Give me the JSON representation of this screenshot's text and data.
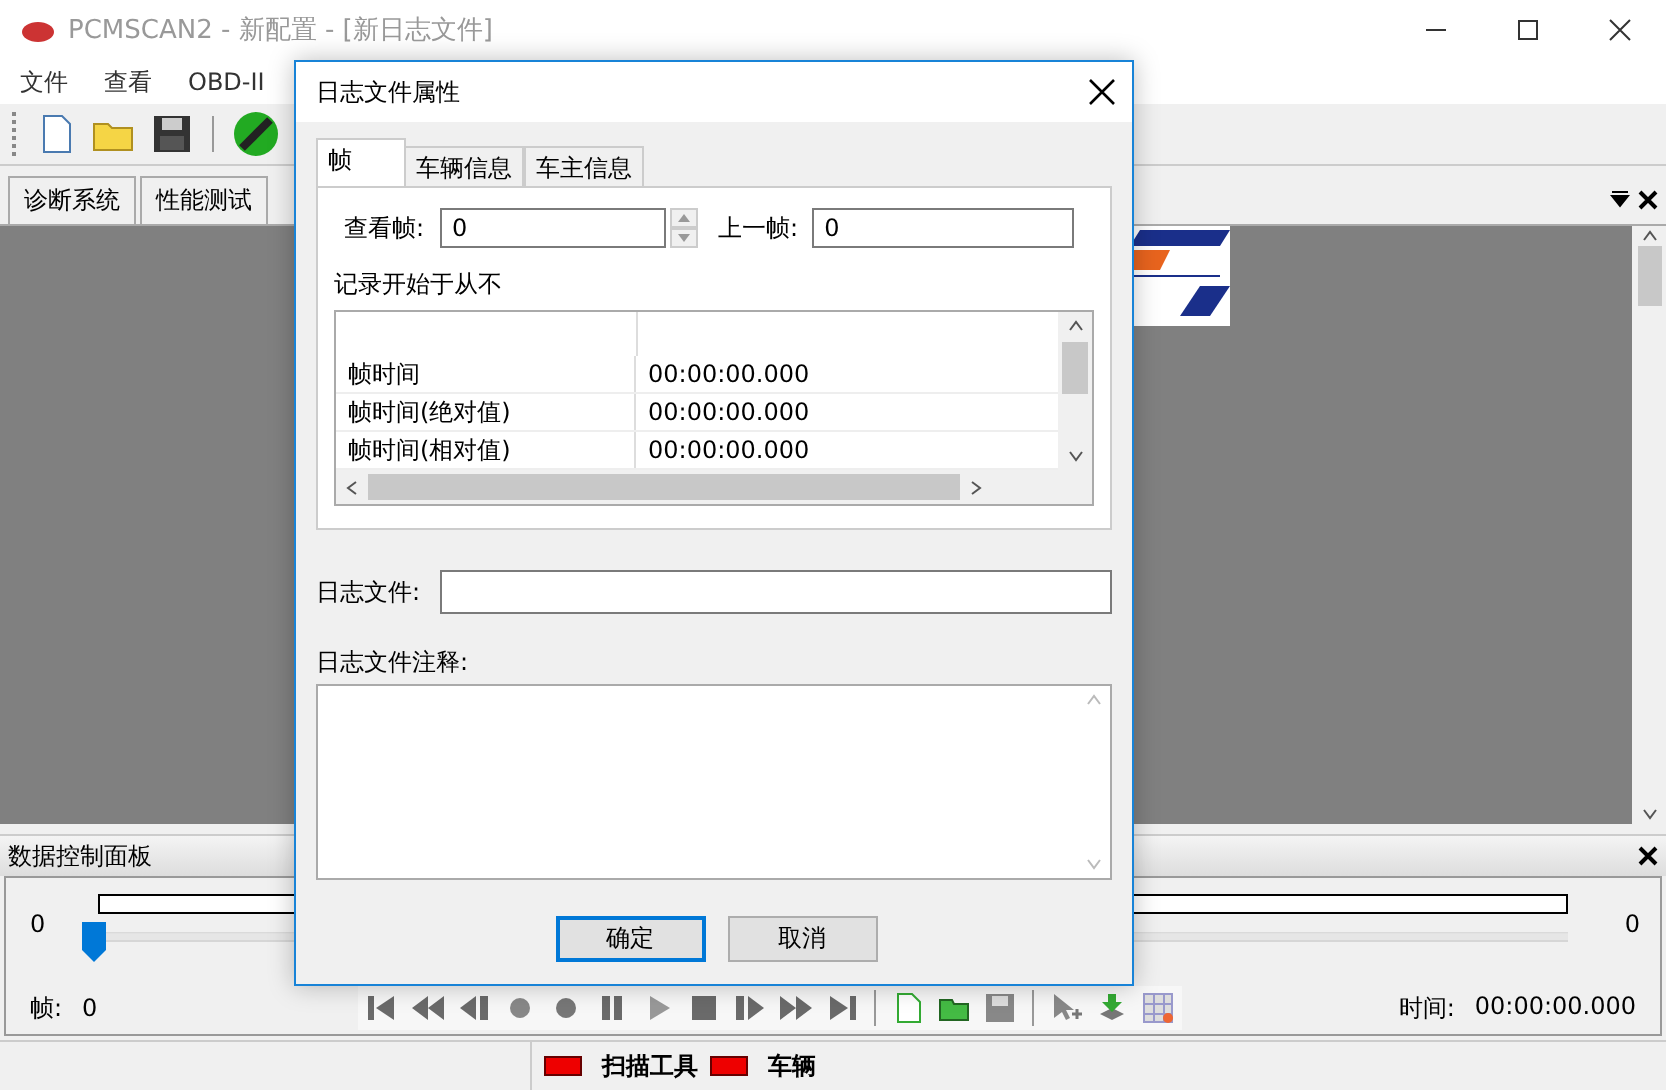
{
  "window": {
    "title": "PCMSCAN2 - 新配置 - [新日志文件]"
  },
  "menu": [
    {
      "label": "文件"
    },
    {
      "label": "查看"
    },
    {
      "label": "OBD-II"
    }
  ],
  "doc_tabs": [
    {
      "label": "诊断系统"
    },
    {
      "label": "性能测试"
    }
  ],
  "data_panel": {
    "title": "数据控制面板",
    "progress": {
      "level": 0
    },
    "slider": {
      "level": 0
    },
    "min_label": "0",
    "max_label": "0",
    "frame_label": "帧:",
    "frame_value": "0",
    "time_label": "时间:",
    "time_value": "00:00:00.000"
  },
  "status_bar": [
    {
      "label": "扫描工具",
      "color": "#ee0000"
    },
    {
      "label": "车辆",
      "color": "#ee0000"
    }
  ],
  "dialog": {
    "title": "日志文件属性",
    "tabs": [
      {
        "label": "帧",
        "selected": true
      },
      {
        "label": "车辆信息",
        "selected": false
      },
      {
        "label": "车主信息",
        "selected": false
      }
    ],
    "view_frame": {
      "label": "查看帧:",
      "value": "0"
    },
    "prev_frame": {
      "label": "上一帧:",
      "value": "0"
    },
    "record_start": "记录开始于从不",
    "frame_table": {
      "rows": [
        {
          "name": "帧时间",
          "value": "00:00:00.000"
        },
        {
          "name": "帧时间(绝对值)",
          "value": "00:00:00.000"
        },
        {
          "name": "帧时间(相对值)",
          "value": "00:00:00.000"
        }
      ]
    },
    "log_file": {
      "label": "日志文件:"
    },
    "log_comment": {
      "label": "日志文件注释:"
    },
    "buttons": [
      {
        "label": "确定",
        "default": true
      },
      {
        "label": "取消",
        "default": false
      }
    ]
  }
}
